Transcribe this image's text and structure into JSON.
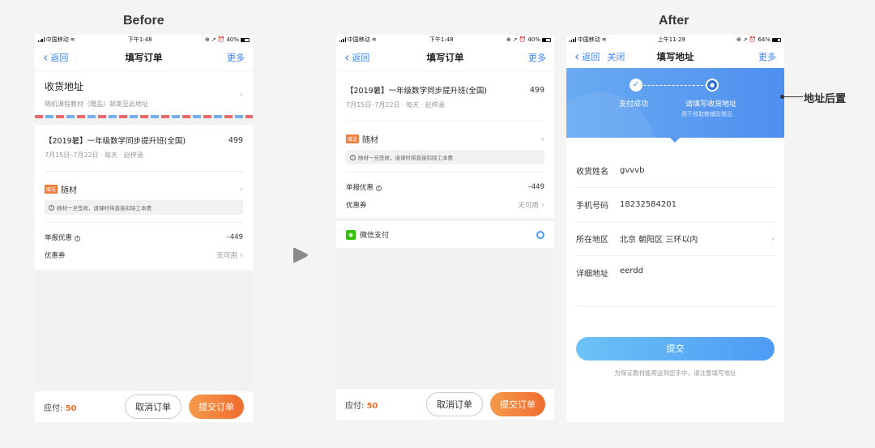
{
  "labels": {
    "before": "Before",
    "after": "After",
    "annotation": "地址后置"
  },
  "status_before": {
    "carrier": "中国移动",
    "time": "下午1:48",
    "battery": "40%"
  },
  "status_after": {
    "carrier": "中国移动",
    "time": "上午11:29",
    "battery": "64%"
  },
  "nav_order": {
    "back": "返回",
    "title": "填写订单",
    "more": "更多"
  },
  "nav_address": {
    "back": "返回",
    "close": "关闭",
    "title": "填写地址",
    "more": "更多"
  },
  "address_block": {
    "title": "收货地址",
    "subtitle": "随机课程教材（赠品）邮寄至此地址"
  },
  "course": {
    "name": "【2019暑】一年级数学同步提升班(全国)",
    "price": "499",
    "schedule": "7月15日–7月22日 · 每天 · 赵梓涵"
  },
  "materials": {
    "tag": "赠送",
    "label": "随材",
    "notice_icon": "!",
    "notice": "随材一旦签收，退课时将直接扣除工本费"
  },
  "discounts": {
    "report_label": "单报优惠",
    "help_icon": "?",
    "report_value": "–449",
    "coupon_label": "优惠券",
    "coupon_value": "无可用"
  },
  "payment": {
    "method": "微信支付"
  },
  "bottom": {
    "pay_label": "应付:",
    "pay_value": "50",
    "cancel": "取消订单",
    "submit": "提交订单"
  },
  "steps": {
    "step1": "支付成功",
    "step2": "请填写收货地址",
    "step2_sub": "用于收取教辅及赠品"
  },
  "form": {
    "name_label": "收货姓名",
    "name_value": "gvvvb",
    "phone_label": "手机号码",
    "phone_value": "18232584201",
    "region_label": "所在地区",
    "region_value": "北京 朝阳区 三环以内",
    "detail_label": "详细地址",
    "detail_value": "eerdd",
    "submit": "提交",
    "note": "为保证教材能寄送到您手中，请注意填写地址"
  },
  "colors": {
    "accent": "#3b82f6",
    "orange": "#ef6d30",
    "wechat": "#2dc100",
    "banner": "#5b9cf3"
  }
}
